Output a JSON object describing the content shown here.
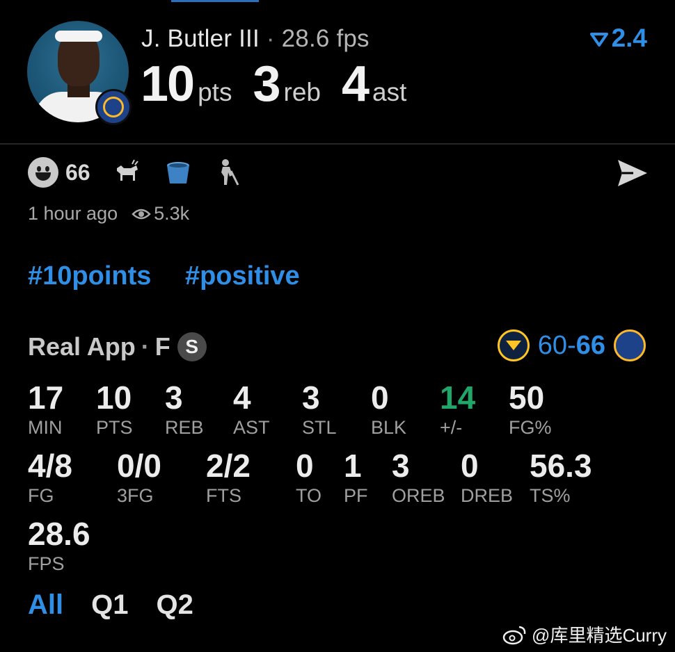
{
  "header": {
    "player_name": "J. Butler III",
    "separator": "·",
    "fps": "28.6 fps",
    "rating": "2.4",
    "pts": "10",
    "pts_label": "pts",
    "reb": "3",
    "reb_label": "reb",
    "ast": "4",
    "ast_label": "ast"
  },
  "reactions": {
    "count": "66",
    "icons": [
      "smiley-icon",
      "goat-icon",
      "bucket-icon",
      "old-man-cane-icon"
    ]
  },
  "meta": {
    "time": "1 hour ago",
    "views": "5.3k"
  },
  "tags": [
    "#10points",
    "#positive"
  ],
  "game": {
    "source": "Real App",
    "separator": "·",
    "position": "F",
    "badge": "S",
    "away_score": "60",
    "dash": "-",
    "home_score": "66",
    "accent": "#2f8fe6",
    "positive_color": "#21a66a"
  },
  "stats_row1": [
    {
      "value": "17",
      "label": "MIN"
    },
    {
      "value": "10",
      "label": "PTS"
    },
    {
      "value": "3",
      "label": "REB"
    },
    {
      "value": "4",
      "label": "AST"
    },
    {
      "value": "3",
      "label": "STL"
    },
    {
      "value": "0",
      "label": "BLK"
    },
    {
      "value": "14",
      "label": "+/-"
    },
    {
      "value": "50",
      "label": "FG%"
    }
  ],
  "stats_row2": [
    {
      "value": "4/8",
      "label": "FG"
    },
    {
      "value": "0/0",
      "label": "3FG"
    },
    {
      "value": "2/2",
      "label": "FTS"
    },
    {
      "value": "0",
      "label": "TO"
    },
    {
      "value": "1",
      "label": "PF"
    },
    {
      "value": "3",
      "label": "OREB"
    },
    {
      "value": "0",
      "label": "DREB"
    },
    {
      "value": "56.3",
      "label": "TS%"
    }
  ],
  "stats_row3": [
    {
      "value": "28.6",
      "label": "FPS"
    }
  ],
  "quarter_tabs": [
    "All",
    "Q1",
    "Q2"
  ],
  "watermark": "@库里精选Curry"
}
